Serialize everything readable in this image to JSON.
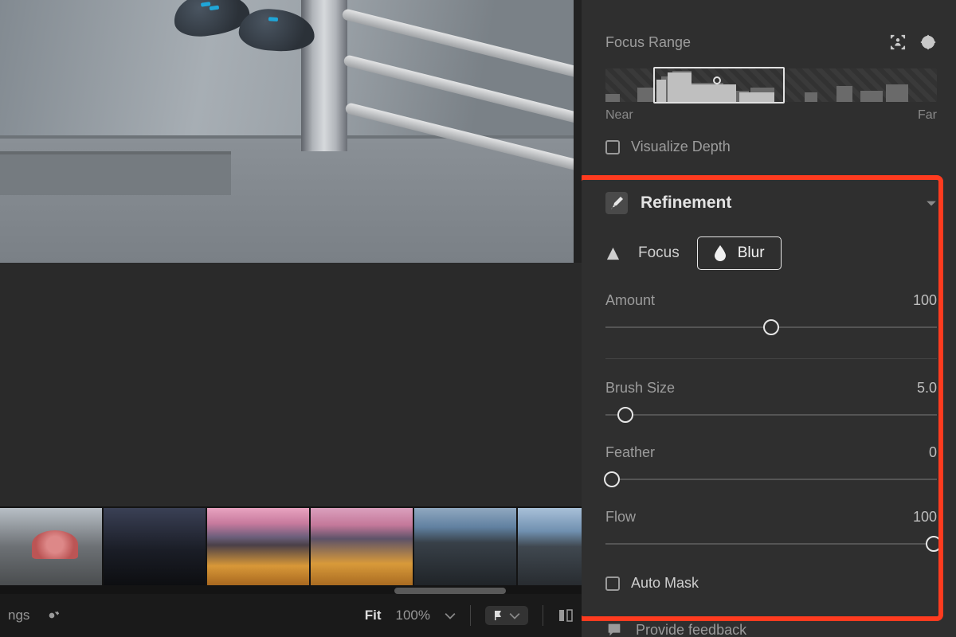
{
  "focus_range": {
    "label": "Focus Range",
    "near": "Near",
    "far": "Far"
  },
  "visualize_depth": {
    "label": "Visualize Depth",
    "checked": false
  },
  "refinement": {
    "title": "Refinement",
    "tabs": {
      "focus": "Focus",
      "blur": "Blur",
      "active": "blur"
    },
    "amount": {
      "label": "Amount",
      "value": "100",
      "pct": 50
    },
    "brush_size": {
      "label": "Brush Size",
      "value": "5.0",
      "pct": 6
    },
    "feather": {
      "label": "Feather",
      "value": "0",
      "pct": 2
    },
    "flow": {
      "label": "Flow",
      "value": "100",
      "pct": 99
    },
    "auto_mask": {
      "label": "Auto Mask",
      "checked": false
    }
  },
  "footer": {
    "feedback": "Provide feedback"
  },
  "bottom": {
    "settings_fragment": "ngs",
    "fit": "Fit",
    "zoom": "100%"
  }
}
